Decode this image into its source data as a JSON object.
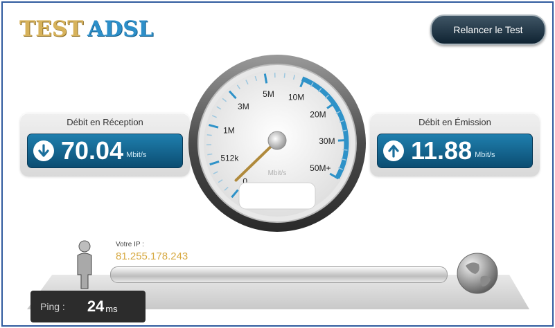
{
  "header": {
    "logo_part1": "TEST",
    "logo_part2": "ADSL",
    "restart_label": "Relancer le Test"
  },
  "download": {
    "title": "Débit en Réception",
    "value": "70.04",
    "unit": "Mbit/s",
    "icon": "arrow-down-icon"
  },
  "upload": {
    "title": "Débit en Émission",
    "value": "11.88",
    "unit": "Mbit/s",
    "icon": "arrow-up-icon"
  },
  "gauge": {
    "unit": "Mbit/s",
    "ticks": [
      "0",
      "512k",
      "1M",
      "3M",
      "5M",
      "10M",
      "20M",
      "30M",
      "50M+"
    ],
    "needle_tick_position": 0.55
  },
  "network": {
    "ip_label": "Votre IP :",
    "ip_value": "81.255.178.243"
  },
  "ping": {
    "label": "Ping :",
    "value": "24",
    "unit": "ms"
  },
  "colors": {
    "accent_blue": "#1f7fae",
    "logo_gold": "#d7b25a",
    "logo_blue": "#2d8fc9",
    "ip_gold": "#d7a941"
  }
}
